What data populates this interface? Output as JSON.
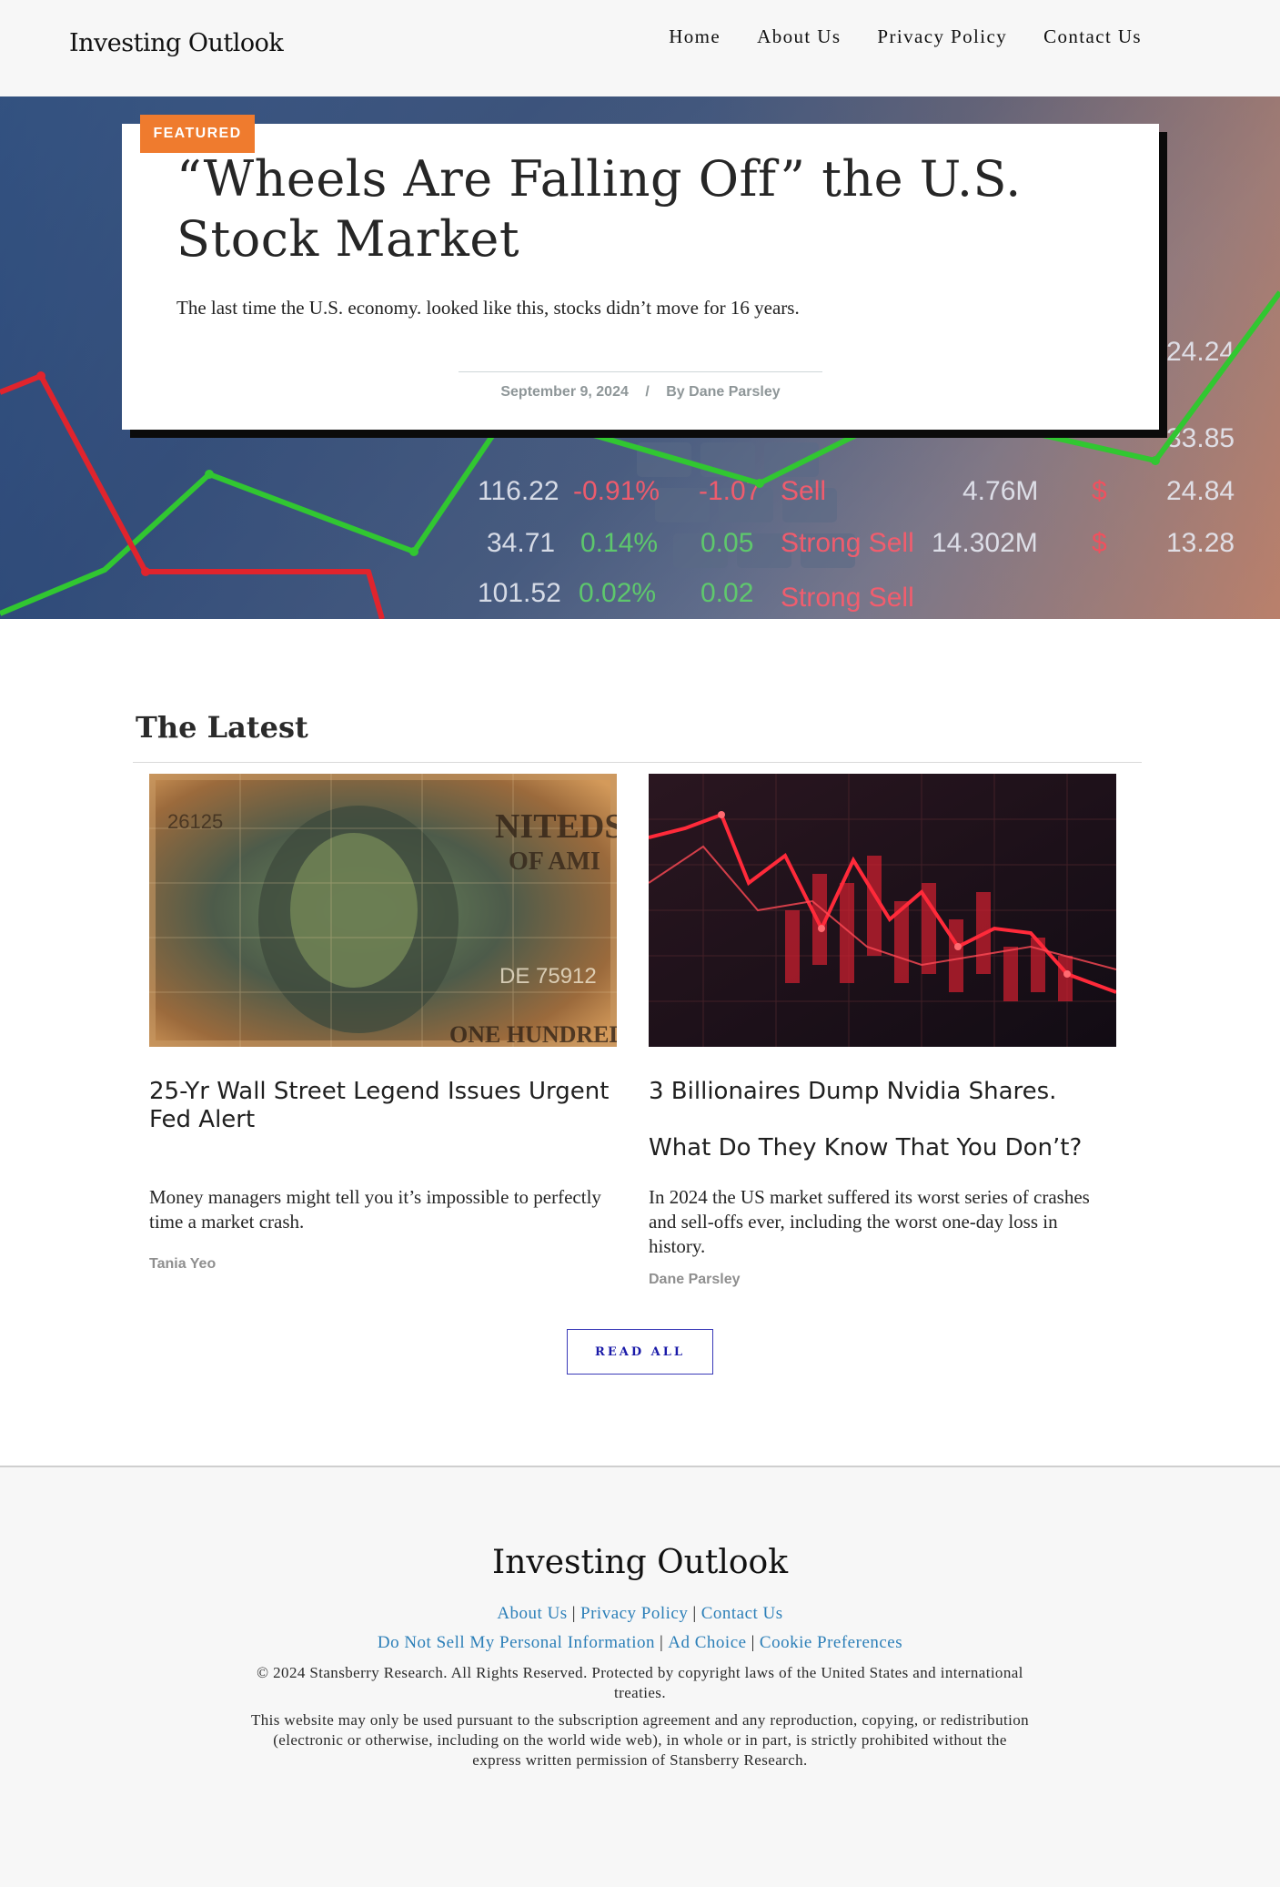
{
  "site": {
    "logo": "Investing Outlook"
  },
  "nav": {
    "items": [
      "Home",
      "About Us",
      "Privacy Policy",
      "Contact Us"
    ]
  },
  "featured": {
    "badge": "FEATURED",
    "title": "“Wheels Are Falling Off” the U.S. Stock Market",
    "dek": "The last time the U.S. economy. looked like this, stocks didn’t move for 16 years.",
    "date": "September 9, 2024",
    "separator": "/",
    "byline": "By Dane Parsley",
    "background_ticker": {
      "col1": [
        "116.22",
        "34.71",
        "101.52"
      ],
      "col2": [
        "-0.91%",
        "0.14%",
        "0.02%"
      ],
      "col3": [
        "-1.07",
        "0.05",
        "0.02"
      ],
      "col4": [
        "Sell",
        "Strong Sell",
        "Strong Sell"
      ],
      "col5": [
        "4.76M",
        "14.302M"
      ],
      "col6": [
        "24.84",
        "13.28",
        "33.85",
        "24.24"
      ]
    }
  },
  "latest": {
    "heading": "The Latest",
    "articles": [
      {
        "title": "25-Yr Wall Street Legend Issues Urgent Fed Alert",
        "title_line2": "",
        "excerpt": "Money managers might tell you it’s impossible to perfectly time a market crash.",
        "author": "Tania Yeo",
        "image": "hundred-dollar-bill-collage"
      },
      {
        "title": "3 Billionaires Dump Nvidia Shares.",
        "title_line2": "What Do They Know That You Don’t?",
        "excerpt": "In 2024 the US market suffered its worst series of crashes and sell-offs ever, including the worst one-day loss in history.",
        "author": "Dane Parsley",
        "image": "red-falling-stock-chart"
      }
    ],
    "read_all": "READ ALL"
  },
  "footer": {
    "logo": "Investing Outlook",
    "links_row1": [
      "About Us",
      "Privacy Policy",
      "Contact Us"
    ],
    "links_row2": [
      "Do Not Sell My Personal Information",
      "Ad Choice",
      "Cookie Preferences"
    ],
    "link_separator": "|",
    "copyright": "© 2024 Stansberry Research. All Rights Reserved. Protected by copyright laws of the United States and international treaties.",
    "legal": "This website may only be used pursuant to the subscription agreement and any reproduction, copying, or redistribution (electronic or otherwise, including on the world wide web), in whole or in part, is strictly prohibited without the express written permission of Stansberry Research."
  },
  "colors": {
    "accent_orange": "#ef7b2e",
    "link_blue": "#2c7fb8",
    "button_blue": "#1a1aa8",
    "footer_bg": "#f7f7f7"
  }
}
